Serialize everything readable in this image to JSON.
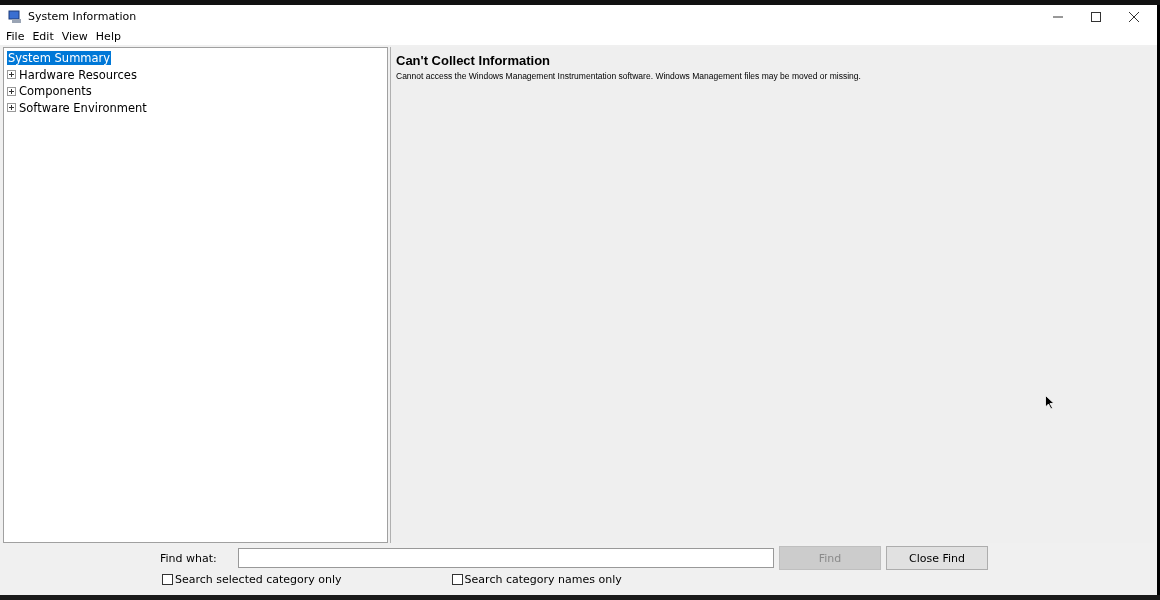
{
  "window": {
    "title": "System Information"
  },
  "menu": [
    "File",
    "Edit",
    "View",
    "Help"
  ],
  "tree": [
    {
      "label": "System Summary",
      "selected": true,
      "expandable": false
    },
    {
      "label": "Hardware Resources",
      "selected": false,
      "expandable": true
    },
    {
      "label": "Components",
      "selected": false,
      "expandable": true
    },
    {
      "label": "Software Environment",
      "selected": false,
      "expandable": true
    }
  ],
  "content": {
    "heading": "Can't Collect Information",
    "message": "Cannot access the Windows Management Instrumentation software. Windows Management files may be moved or missing."
  },
  "find_bar": {
    "label": "Find what:",
    "find_button": {
      "label": "Find",
      "disabled": true
    },
    "close_button": {
      "label": "Close Find",
      "disabled": false
    },
    "options": [
      {
        "label": "Search selected category only",
        "checked": false
      },
      {
        "label": "Search category names only",
        "checked": false
      }
    ]
  }
}
